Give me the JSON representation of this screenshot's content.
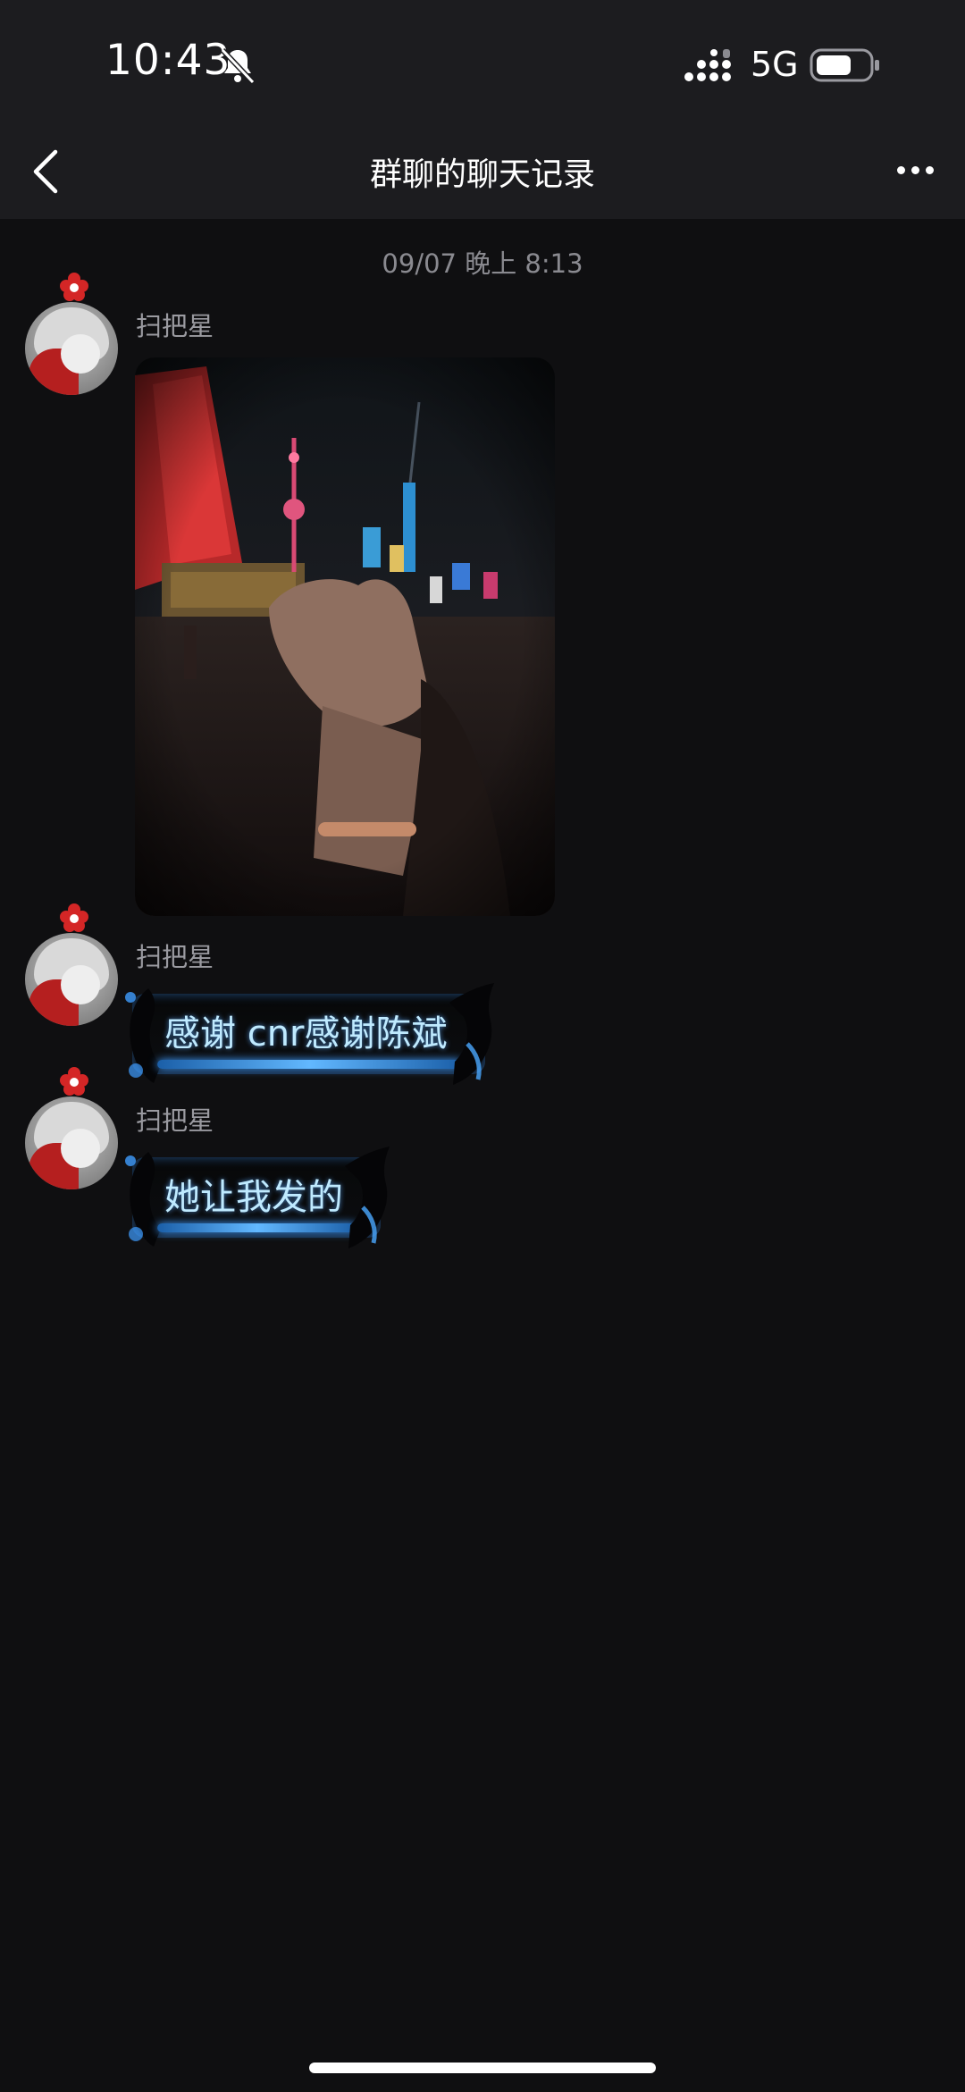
{
  "status_bar": {
    "time": "10:43",
    "network": "5G",
    "icons": [
      "bell-muted-icon",
      "signal-bars-icon",
      "battery-icon"
    ]
  },
  "header": {
    "title": "群聊的聊天记录",
    "icons": [
      "chevron-left-icon",
      "more-dots-icon"
    ]
  },
  "chat": {
    "timestamp": "09/07 晚上 8:13",
    "messages": [
      {
        "sender": "扫把星",
        "type": "image",
        "image_desc_icon": "photo-night-skyline-holding-hands"
      },
      {
        "sender": "扫把星",
        "type": "text",
        "text": "感谢 cnr感谢陈斌"
      },
      {
        "sender": "扫把星",
        "type": "text",
        "text": "她让我发的"
      }
    ]
  },
  "colors": {
    "background": "#0f0f11",
    "header_bg": "#1c1c1f",
    "bubble_text": "#bfeaff",
    "bubble_glow": "#62b8ff",
    "sender_name": "#9a9aa0"
  }
}
